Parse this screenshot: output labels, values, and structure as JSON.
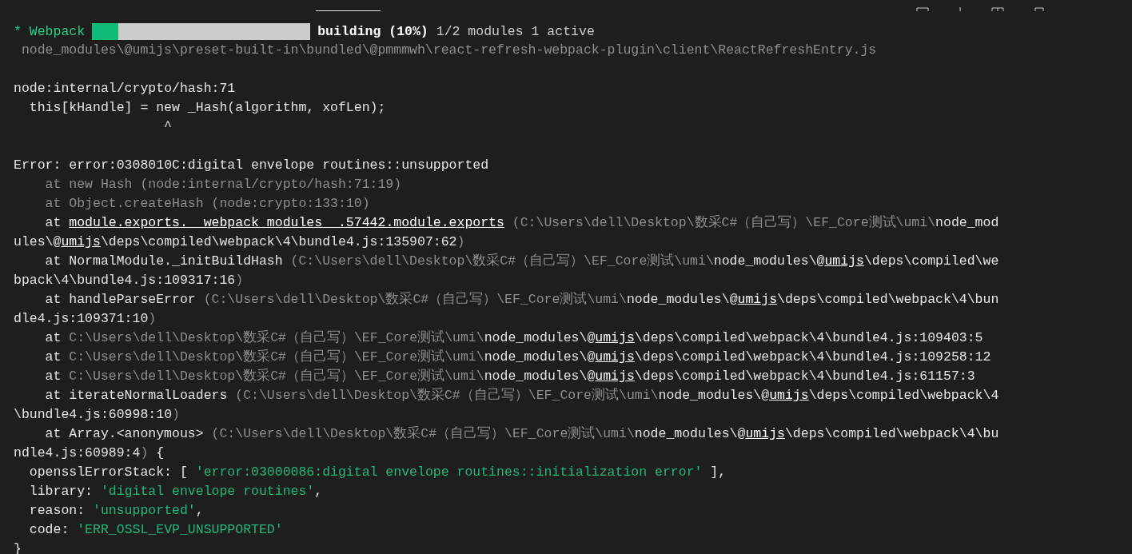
{
  "terminal": {
    "progress": {
      "label": "* Webpack",
      "level": 0.12,
      "status": "building (10%)",
      "detail": "1/2 modules 1 active"
    },
    "lines": [
      {
        "kind": "sub",
        "segments": [
          {
            "kind": "dim",
            "text": "node_modules\\@umijs\\preset-built-in\\bundled\\@pmmmwh\\react-refresh-webpack-plugin\\client\\ReactRefreshEntry.js"
          }
        ]
      },
      {
        "kind": "blank"
      },
      {
        "kind": "plain",
        "segments": [
          {
            "kind": "text",
            "text": "node:internal/crypto/hash:71"
          }
        ]
      },
      {
        "kind": "prop",
        "segments": [
          {
            "kind": "text",
            "text": "this[kHandle] = new _Hash(algorithm, xofLen);"
          }
        ]
      },
      {
        "kind": "caret",
        "segments": [
          {
            "kind": "text",
            "text": "^"
          }
        ]
      },
      {
        "kind": "blank"
      },
      {
        "kind": "plain",
        "segments": [
          {
            "kind": "text",
            "text": "Error: error:0308010C:digital envelope routines::unsupported"
          }
        ]
      },
      {
        "kind": "frame",
        "segments": [
          {
            "kind": "dim",
            "text": "at new Hash (node:internal/crypto/hash:71:19)"
          }
        ]
      },
      {
        "kind": "frame",
        "segments": [
          {
            "kind": "dim",
            "text": "at Object.createHash (node:crypto:133:10)"
          }
        ]
      },
      {
        "kind": "frame",
        "segments": [
          {
            "kind": "text",
            "text": "at "
          },
          {
            "kind": "link",
            "text": "module.exports.__webpack_modules__.57442.module.exports"
          },
          {
            "kind": "dim",
            "text": " (C:\\Users\\dell\\Desktop\\数采C#（自己写）\\EF_Core测试\\umi\\"
          },
          {
            "kind": "text",
            "text": "node_mod"
          }
        ]
      },
      {
        "kind": "plain",
        "segments": [
          {
            "kind": "text",
            "text": "ules\\@"
          },
          {
            "kind": "link",
            "text": "umijs"
          },
          {
            "kind": "text",
            "text": "\\deps\\compiled\\webpack\\4\\bundle4.js:135907:62"
          },
          {
            "kind": "dim",
            "text": ")"
          }
        ]
      },
      {
        "kind": "frame",
        "segments": [
          {
            "kind": "text",
            "text": "at NormalModule._initBuildHash "
          },
          {
            "kind": "dim",
            "text": "(C:\\Users\\dell\\Desktop\\数采C#（自己写）\\EF_Core测试\\umi\\"
          },
          {
            "kind": "text",
            "text": "node_modules\\@"
          },
          {
            "kind": "link",
            "text": "umijs"
          },
          {
            "kind": "text",
            "text": "\\deps\\compiled\\we"
          }
        ]
      },
      {
        "kind": "plain",
        "segments": [
          {
            "kind": "text",
            "text": "bpack\\4\\bundle4.js:109317:16"
          },
          {
            "kind": "dim",
            "text": ")"
          }
        ]
      },
      {
        "kind": "frame",
        "segments": [
          {
            "kind": "text",
            "text": "at handleParseError "
          },
          {
            "kind": "dim",
            "text": "(C:\\Users\\dell\\Desktop\\数采C#（自己写）\\EF_Core测试\\umi\\"
          },
          {
            "kind": "text",
            "text": "node_modules\\@"
          },
          {
            "kind": "link",
            "text": "umijs"
          },
          {
            "kind": "text",
            "text": "\\deps\\compiled\\webpack\\4\\bun"
          }
        ]
      },
      {
        "kind": "plain",
        "segments": [
          {
            "kind": "text",
            "text": "dle4.js:109371:10"
          },
          {
            "kind": "dim",
            "text": ")"
          }
        ]
      },
      {
        "kind": "frame",
        "segments": [
          {
            "kind": "text",
            "text": "at "
          },
          {
            "kind": "dim",
            "text": "C:\\Users\\dell\\Desktop\\数采C#（自己写）\\EF_Core测试\\umi\\"
          },
          {
            "kind": "text",
            "text": "node_modules\\@"
          },
          {
            "kind": "link",
            "text": "umijs"
          },
          {
            "kind": "text",
            "text": "\\deps\\compiled\\webpack\\4\\bundle4.js:109403:5"
          }
        ]
      },
      {
        "kind": "frame",
        "segments": [
          {
            "kind": "text",
            "text": "at "
          },
          {
            "kind": "dim",
            "text": "C:\\Users\\dell\\Desktop\\数采C#（自己写）\\EF_Core测试\\umi\\"
          },
          {
            "kind": "text",
            "text": "node_modules\\@"
          },
          {
            "kind": "link",
            "text": "umijs"
          },
          {
            "kind": "text",
            "text": "\\deps\\compiled\\webpack\\4\\bundle4.js:109258:12"
          }
        ]
      },
      {
        "kind": "frame",
        "segments": [
          {
            "kind": "text",
            "text": "at "
          },
          {
            "kind": "dim",
            "text": "C:\\Users\\dell\\Desktop\\数采C#（自己写）\\EF_Core测试\\umi\\"
          },
          {
            "kind": "text",
            "text": "node_modules\\@"
          },
          {
            "kind": "link",
            "text": "umijs"
          },
          {
            "kind": "text",
            "text": "\\deps\\compiled\\webpack\\4\\bundle4.js:61157:3"
          }
        ]
      },
      {
        "kind": "frame",
        "segments": [
          {
            "kind": "text",
            "text": "at iterateNormalLoaders "
          },
          {
            "kind": "dim",
            "text": "(C:\\Users\\dell\\Desktop\\数采C#（自己写）\\EF_Core测试\\umi\\"
          },
          {
            "kind": "text",
            "text": "node_modules\\@"
          },
          {
            "kind": "link",
            "text": "umijs"
          },
          {
            "kind": "text",
            "text": "\\deps\\compiled\\webpack\\4"
          }
        ]
      },
      {
        "kind": "plain",
        "segments": [
          {
            "kind": "text",
            "text": "\\bundle4.js:60998:10"
          },
          {
            "kind": "dim",
            "text": ")"
          }
        ]
      },
      {
        "kind": "frame",
        "segments": [
          {
            "kind": "text",
            "text": "at Array.<anonymous> "
          },
          {
            "kind": "dim",
            "text": "(C:\\Users\\dell\\Desktop\\数采C#（自己写）\\EF_Core测试\\umi\\"
          },
          {
            "kind": "text",
            "text": "node_modules\\@"
          },
          {
            "kind": "link",
            "text": "umijs"
          },
          {
            "kind": "text",
            "text": "\\deps\\compiled\\webpack\\4\\bu"
          }
        ]
      },
      {
        "kind": "plain",
        "segments": [
          {
            "kind": "text",
            "text": "ndle4.js:60989:4"
          },
          {
            "kind": "dim",
            "text": ")"
          },
          {
            "kind": "text",
            "text": " {"
          }
        ]
      },
      {
        "kind": "prop",
        "segments": [
          {
            "kind": "text",
            "text": "opensslErrorStack: [ "
          },
          {
            "kind": "string",
            "text": "'error:03000086:digital envelope routines::initialization error'"
          },
          {
            "kind": "text",
            "text": " ],"
          }
        ]
      },
      {
        "kind": "prop",
        "segments": [
          {
            "kind": "text",
            "text": "library: "
          },
          {
            "kind": "string",
            "text": "'digital envelope routines'"
          },
          {
            "kind": "text",
            "text": ","
          }
        ]
      },
      {
        "kind": "prop",
        "segments": [
          {
            "kind": "text",
            "text": "reason: "
          },
          {
            "kind": "string",
            "text": "'unsupported'"
          },
          {
            "kind": "text",
            "text": ","
          }
        ]
      },
      {
        "kind": "prop",
        "segments": [
          {
            "kind": "text",
            "text": "code: "
          },
          {
            "kind": "string",
            "text": "'ERR_OSSL_EVP_UNSUPPORTED'"
          }
        ]
      },
      {
        "kind": "plain",
        "segments": [
          {
            "kind": "text",
            "text": "}"
          }
        ]
      }
    ]
  }
}
